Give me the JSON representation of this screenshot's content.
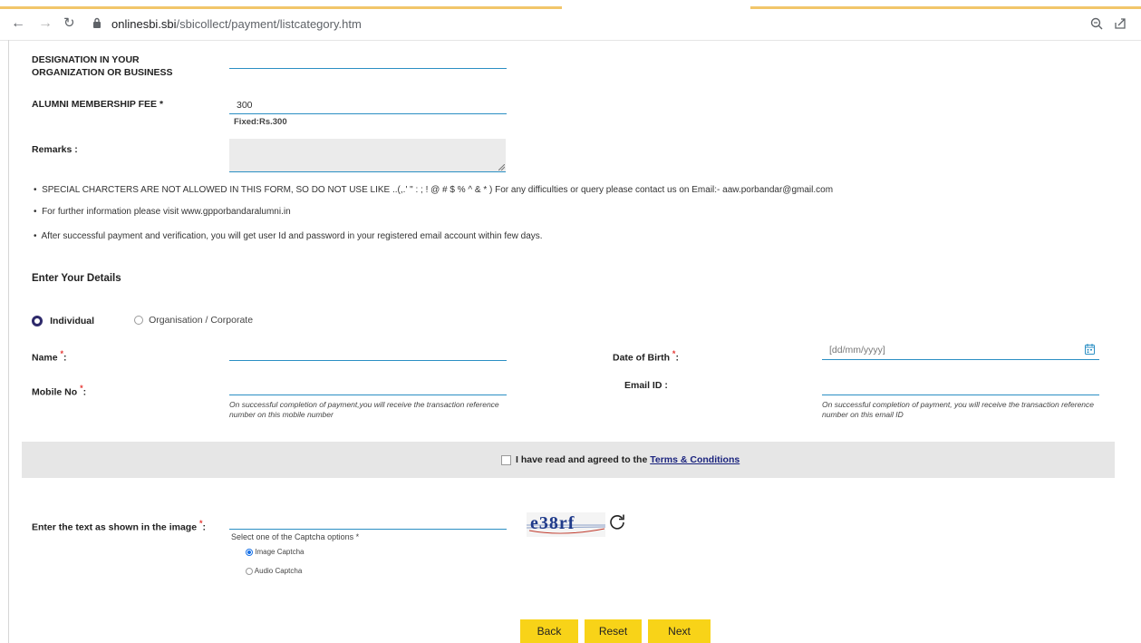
{
  "browser": {
    "url_host": "onlinesbi.sbi",
    "url_path": "/sbicollect/payment/listcategory.htm"
  },
  "form": {
    "designation_label": "DESIGNATION IN YOUR ORGANIZATION OR BUSINESS",
    "fee_label": "ALUMNI MEMBERSHIP FEE *",
    "fee_value": "300",
    "fee_note": "Fixed:Rs.300",
    "remarks_label": "Remarks :"
  },
  "notes": [
    "SPECIAL CHARCTERS ARE NOT ALLOWED IN THIS FORM, SO DO NOT USE LIKE ..(,.' \" : ; ! @ # $ % ^ & * ) For any difficulties or query please contact us on Email:- aaw.porbandar@gmail.com",
    "For further information please visit www.gpporbandaralumni.in",
    "After successful payment and verification, you will get user Id and password in your registered email account within few days."
  ],
  "details": {
    "heading": "Enter Your Details",
    "individual_label": "Individual",
    "organisation_label": "Organisation / Corporate",
    "name_label": "Name",
    "dob_label": "Date of Birth",
    "dob_placeholder": "[dd/mm/yyyy]",
    "mobile_label": "Mobile No",
    "email_label": "Email ID :",
    "mobile_hint": "On successful completion of payment,you will receive the transaction reference number on this mobile number",
    "email_hint": "On successful completion of payment, you will receive the transaction reference number on this email ID"
  },
  "terms": {
    "prefix": "I have read and agreed to the",
    "link": "Terms & Conditions"
  },
  "captcha": {
    "label": "Enter the text as shown in the image",
    "select_label": "Select one of the Captcha options *",
    "image_option": "Image Captcha",
    "audio_option": "Audio Captcha",
    "captcha_text": "e38rf"
  },
  "buttons": {
    "back": "Back",
    "reset": "Reset",
    "next": "Next"
  },
  "colors": {
    "accent_line": "#2b8fc4",
    "button_yellow": "#f8d318",
    "terms_band": "#e6e6e6"
  }
}
